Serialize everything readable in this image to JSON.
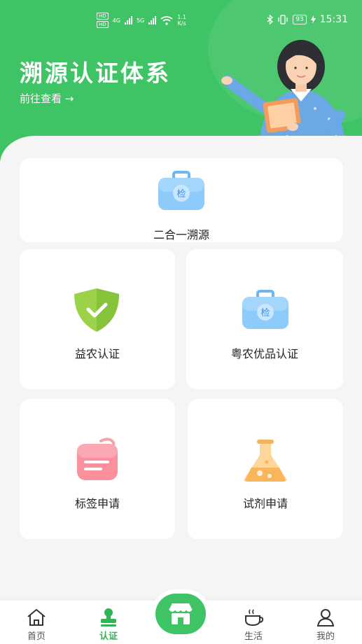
{
  "status_bar": {
    "hd1": "HD",
    "hd2": "HD",
    "net1": "4G",
    "net2": "5G",
    "speed": "1.1",
    "speed_unit": "K/s",
    "battery": "93",
    "time": "15:31"
  },
  "header": {
    "title": "溯源认证体系",
    "link": "前往查看 →"
  },
  "cards": {
    "two_in_one": "二合一溯源",
    "yinong": "益农认证",
    "yuenong": "粤农优品认证",
    "label_apply": "标签申请",
    "reagent_apply": "试剂申请"
  },
  "badge_char": "检",
  "nav": {
    "home": "首页",
    "cert": "认证",
    "life": "生活",
    "mine": "我的"
  },
  "colors": {
    "primary": "#3ec464",
    "active": "#2fb556"
  }
}
